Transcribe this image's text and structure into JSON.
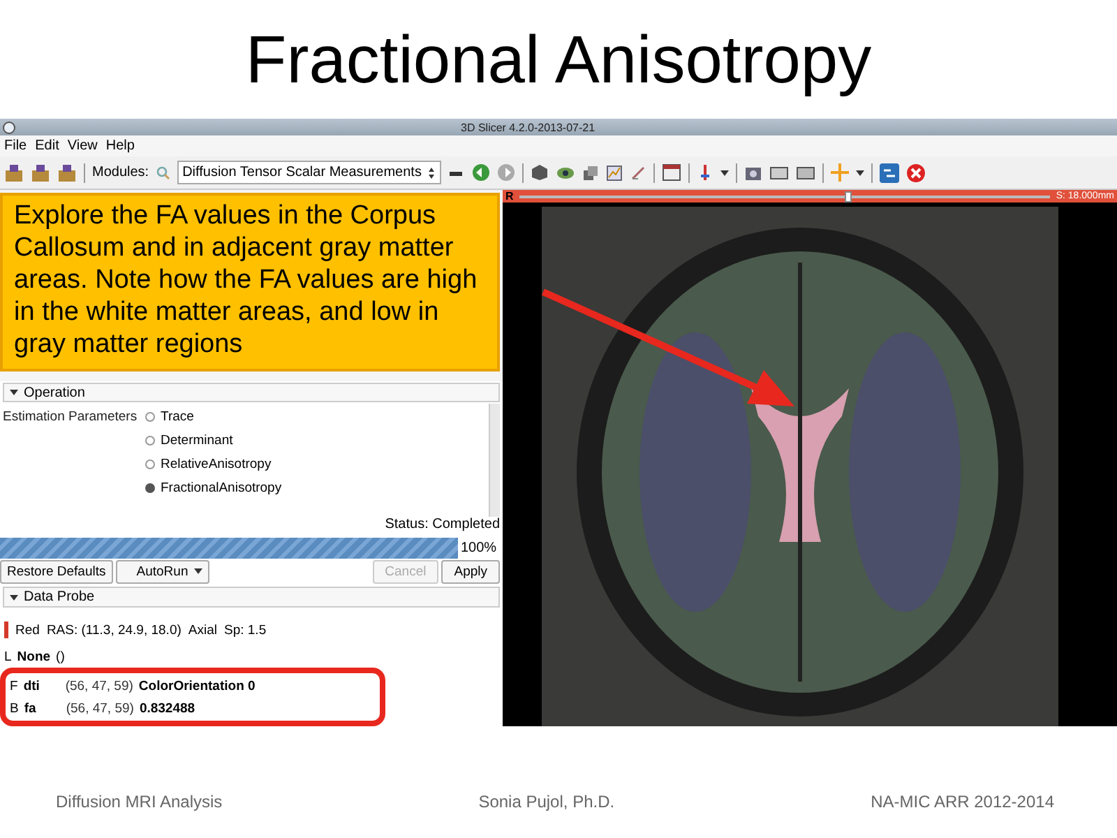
{
  "slide": {
    "title": "Fractional Anisotropy"
  },
  "window": {
    "title": "3D Slicer 4.2.0-2013-07-21"
  },
  "menu": [
    "File",
    "Edit",
    "View",
    "Help"
  ],
  "toolbar": {
    "modules_label": "Modules:",
    "module": "Diffusion Tensor Scalar Measurements"
  },
  "slice_view": {
    "label": "R",
    "level": 0.62,
    "reading": "S: 18.000mm"
  },
  "callout": {
    "text": "Explore the FA values in the Corpus Callosum and in adjacent gray matter areas. Note how the FA values are high in the white matter areas, and low in  gray matter regions"
  },
  "operation": {
    "header": "Operation",
    "param_label": "Estimation Parameters",
    "options": [
      {
        "label": "Trace",
        "selected": false
      },
      {
        "label": "Determinant",
        "selected": false
      },
      {
        "label": "RelativeAnisotropy",
        "selected": false
      },
      {
        "label": "FractionalAnisotropy",
        "selected": true
      }
    ]
  },
  "status": "Status: Completed",
  "progress": {
    "level": 1,
    "reading": "100%"
  },
  "setup_buttons": [
    {
      "label": "Restore Defaults",
      "kind": "plain",
      "disabled": false
    },
    {
      "label": "AutoRun",
      "kind": "split",
      "disabled": false
    }
  ],
  "run_buttons": [
    {
      "label": "Cancel",
      "kind": "plain",
      "disabled": true
    },
    {
      "label": "Apply",
      "kind": "plain",
      "disabled": false
    }
  ],
  "data_probe": {
    "header": "Data Probe",
    "view": "Red",
    "ras": "RAS: (11.3, 24.9, 18.0)",
    "orientation": "Axial",
    "spacing": "Sp: 1.5",
    "layers": [
      {
        "layer": "L",
        "name": "None",
        "coords": "()"
      }
    ],
    "highlighted_layers": [
      {
        "layer": "F",
        "name": "dti",
        "coords": "(56, 47, 59)",
        "value": "ColorOrientation 0"
      },
      {
        "layer": "B",
        "name": "fa",
        "coords": "(56, 47, 59)",
        "value": "0.832488"
      }
    ]
  },
  "footer": [
    "Diffusion MRI Analysis",
    "Sonia Pujol, Ph.D.",
    "NA-MIC ARR 2012-2014"
  ]
}
